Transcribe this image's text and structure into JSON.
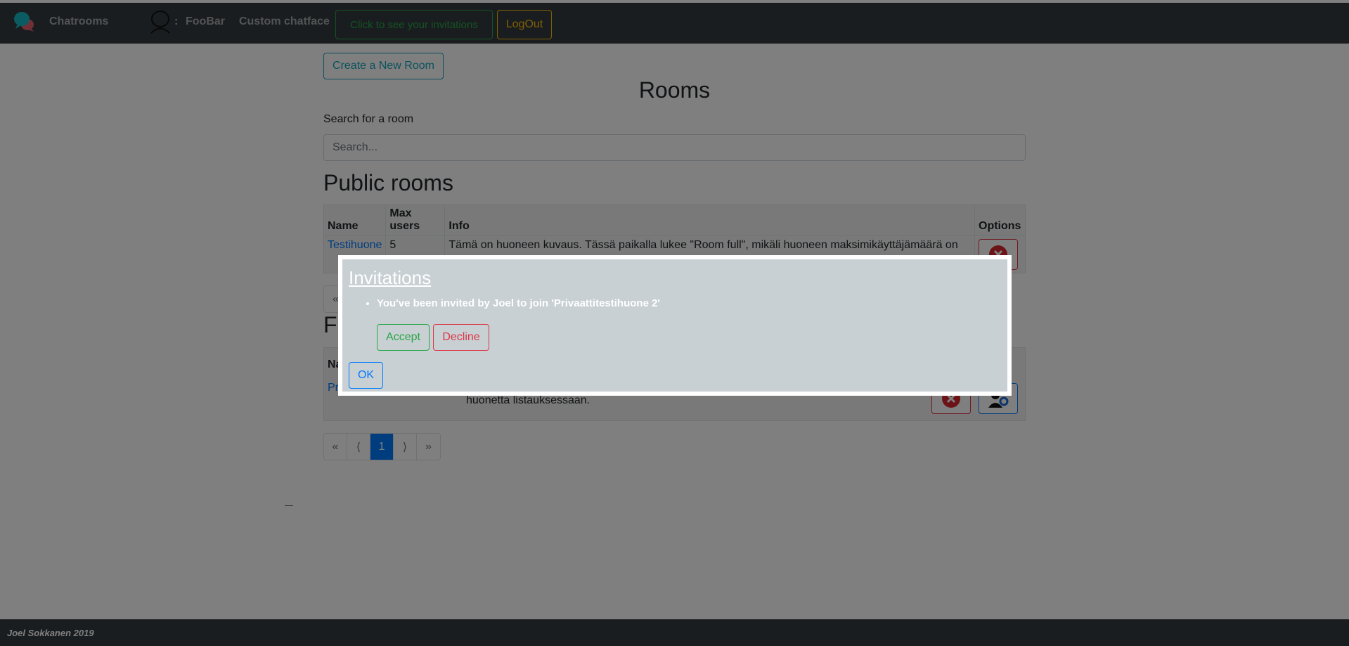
{
  "navbar": {
    "brand": "Chatrooms",
    "user_separator": ":",
    "username": "FooBar",
    "custom_chatface": "Custom chatface",
    "invitations_button": "Click to see your invitations",
    "logout": "LogOut"
  },
  "main": {
    "create_room": "Create a New Room",
    "title": "Rooms",
    "search_label": "Search for a room",
    "search_placeholder": "Search..."
  },
  "public_rooms": {
    "title": "Public rooms",
    "headers": {
      "name": "Name",
      "max_users": "Max users",
      "info": "Info",
      "options": "Options"
    },
    "rows": [
      {
        "name": "Testihuone",
        "max_users": "5",
        "info": "Tämä on huoneen kuvaus. Tässä paikalla lukee \"Room full\", mikäli huoneen maksimikäyttäjämäärä on"
      }
    ]
  },
  "private_rooms": {
    "title_visible": "F",
    "header_visible": "Na",
    "row_name_visible": "Pr",
    "info_tail": "huonetta listauksessaan."
  },
  "pagination": {
    "first": "«",
    "prev": "⟨",
    "page": "1",
    "next": "⟩",
    "last": "»"
  },
  "modal": {
    "title": "Invitations",
    "invitation": "You've been invited by Joel to join 'Privaattitestihuone 2'",
    "accept": "Accept",
    "decline": "Decline",
    "ok": "OK"
  },
  "footer": {
    "text": "Joel Sokkanen 2019"
  },
  "colors": {
    "navbar": "#343a40",
    "primary": "#007bff",
    "success": "#28a745",
    "danger": "#dc3545",
    "warning": "#ffc107",
    "info": "#17a2b8"
  },
  "icons": {
    "logo": "chat-bubbles-icon",
    "avatar": "user-avatar-icon",
    "delete": "delete-icon",
    "manage": "manage-users-icon"
  }
}
